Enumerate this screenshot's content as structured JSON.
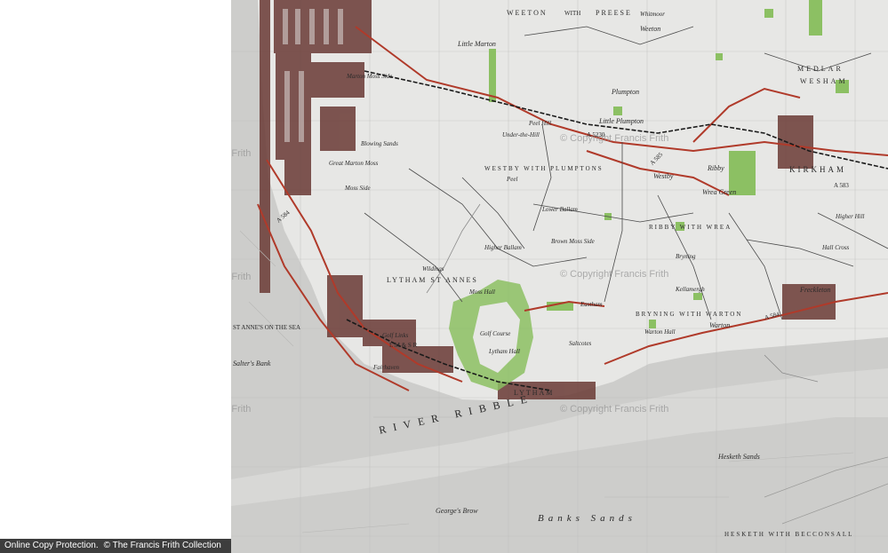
{
  "map": {
    "watermark": "© Copyright Francis Frith",
    "colors": {
      "land": "#e7e7e5",
      "sea": "#c9c9c7",
      "road": "#b03a2a",
      "woodland": "#8cc063",
      "built": "#6a3a35"
    },
    "labels": {
      "little_marton": "Little Marton",
      "weeton": "WEETON",
      "with": "WITH",
      "preese": "PREESE",
      "whitmoor": "Whitmoor",
      "weeton_small": "Weeton",
      "medlar": "MEDLAR",
      "wesham": "WESHAM",
      "marton_moss_side": "Marton Moss Side",
      "flumpton": "Plumpton",
      "peel_hill": "Peel Hill",
      "little_plumpton": "Little Plumpton",
      "under_the_hill": "Under-the-Hill",
      "westby_with_plumptons": "WESTBY WITH PLUMPTONS",
      "westby": "Westby",
      "peel": "Peel",
      "great_marton_moss": "Great Marton Moss",
      "blowing_sands": "Blowing Sands",
      "moss_side": "Moss Side",
      "ribby": "Ribby",
      "wrea_green": "Wrea Green",
      "kirkham": "KIRKHAM",
      "lower_ballam": "Lower Ballam",
      "higher_ballam": "Higher Ballam",
      "brown_moss_side": "Brown Moss Side",
      "ribby_with_wrea": "RIBBY WITH WREA",
      "hall_cross": "Hall Cross",
      "bryning": "Bryning",
      "kellamergh": "Kellamergh",
      "freckleton": "Freckleton",
      "lytham_st_annes": "LYTHAM ST ANNES",
      "wildings": "Wildings",
      "moss_hall": "Moss Hall",
      "st_annes_on_the_sea": "ST ANNE'S ON THE SEA",
      "golf_links": "Golf Links",
      "lms": "L M & S R",
      "golf_course": "Golf Course",
      "lytham_hall": "Lytham Hall",
      "eastham": "Eastham",
      "saltcotes": "Saltcotes",
      "bryning_with_warton": "BRYNING WITH WARTON",
      "warton": "Warton",
      "warton_hall": "Warton Hall",
      "salters_bank": "Salter's Bank",
      "fairhaven": "Fairhaven",
      "lytham": "LYTHAM",
      "river_ribble": "RIVER RIBBLE",
      "hesketh_sands": "Hesketh Sands",
      "georges_brow": "George's Brow",
      "banks_sands": "Banks Sands",
      "hesketh_with_becconsall": "HESKETH WITH BECCONSALL",
      "a584": "A 584",
      "a583": "A 583",
      "a5230": "A 5230",
      "a585": "A 585",
      "a584b": "A 584",
      "higher_hill": "Higher Hill"
    }
  },
  "footer": {
    "online_copy": "Online Copy Protection.",
    "copyright": "© The Francis Frith Collection"
  }
}
